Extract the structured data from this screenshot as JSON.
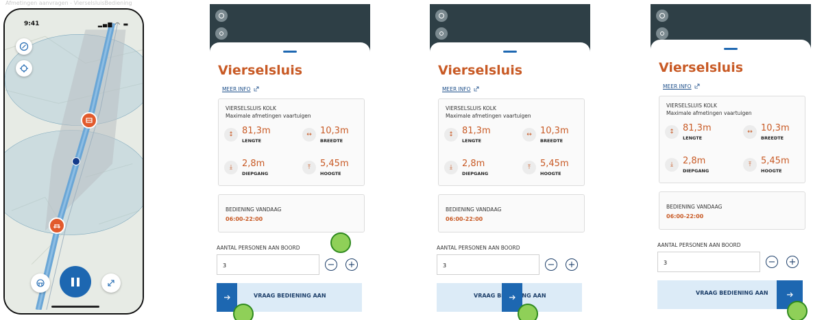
{
  "header_caption": "Afmetingen aanvragen - VierselsluisBediening",
  "colors": {
    "accent_orange": "#c85a25",
    "primary_blue": "#1d67b1",
    "touch_green": "#8fd058"
  },
  "phone": {
    "time": "9:41",
    "status_icons": "signal-icon wifi-icon battery-icon",
    "map_controls": [
      "compass-icon",
      "locate-icon"
    ],
    "bottom_controls": [
      "lock-bridge-icon",
      "pause-icon",
      "expand-icon"
    ]
  },
  "panels": [
    {
      "title": "Vierselsluis",
      "more_info": "MEER INFO",
      "kolk": "VIERSELSLUIS KOLK",
      "max_dims": "Maximale afmetingen vaartuigen",
      "stats": [
        {
          "value": "81,3m",
          "label": "LENGTE"
        },
        {
          "value": "10,3m",
          "label": "BREEDTE"
        },
        {
          "value": "2,8m",
          "label": "DIEPGANG"
        },
        {
          "value": "5,45m",
          "label": "HOOGTE"
        }
      ],
      "bediening_label": "BEDIENING VANDAAG",
      "bediening_time": "06:00-22:00",
      "personen_label": "AANTAL PERSONEN AAN BOORD",
      "personen_value": "3",
      "button_label": "VRAAG BEDIENING AAN"
    },
    {
      "title": "Vierselsluis",
      "more_info": "MEER INFO",
      "kolk": "VIERSELSLUIS KOLK",
      "max_dims": "Maximale afmetingen vaartuigen",
      "stats": [
        {
          "value": "81,3m",
          "label": "LENGTE"
        },
        {
          "value": "10,3m",
          "label": "BREEDTE"
        },
        {
          "value": "2,8m",
          "label": "DIEPGANG"
        },
        {
          "value": "5,45m",
          "label": "HOOGTE"
        }
      ],
      "bediening_label": "BEDIENING VANDAAG",
      "bediening_time": "06:00-22:00",
      "personen_label": "AANTAL PERSONEN AAN BOORD",
      "personen_value": "3",
      "button_label": "VRAAG BEDIENING AAN"
    },
    {
      "title": "Vierselsluis",
      "more_info": "MEER INFO",
      "kolk": "VIERSELSLUIS KOLK",
      "max_dims": "Maximale afmetingen vaartuigen",
      "stats": [
        {
          "value": "81,3m",
          "label": "LENGTE"
        },
        {
          "value": "10,3m",
          "label": "BREEDTE"
        },
        {
          "value": "2,8m",
          "label": "DIEPGANG"
        },
        {
          "value": "5,45m",
          "label": "HOOGTE"
        }
      ],
      "bediening_label": "BEDIENING VANDAAG",
      "bediening_time": "06:00-22:00",
      "personen_label": "AANTAL PERSONEN AAN BOORD",
      "personen_value": "3",
      "button_label": "VRAAG BEDIENING AAN"
    }
  ]
}
